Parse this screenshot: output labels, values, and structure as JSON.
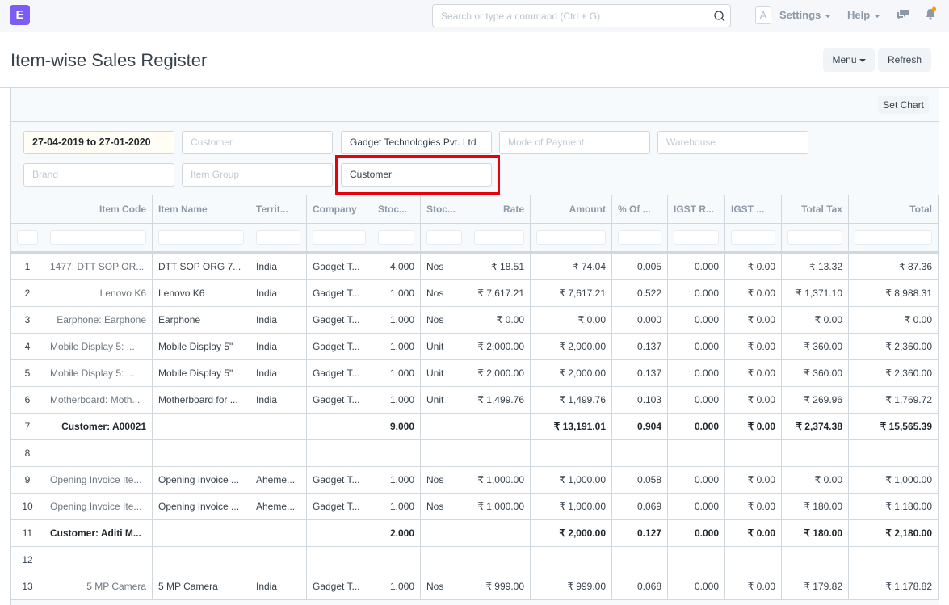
{
  "navbar": {
    "logo_letter": "E",
    "search_placeholder": "Search or type a command (Ctrl + G)",
    "avatar_letter": "A",
    "settings_label": "Settings",
    "help_label": "Help",
    "icons": [
      "search-icon",
      "chat-icon",
      "bell-icon"
    ],
    "notification_dot_color": "#ff9800",
    "brand_color": "#7b5cf6"
  },
  "page": {
    "title": "Item-wise Sales Register",
    "menu_label": "Menu",
    "refresh_label": "Refresh",
    "set_chart_label": "Set Chart"
  },
  "filters": {
    "date_range": "27-04-2019 to 27-01-2020",
    "customer_placeholder": "Customer",
    "company": "Gadget Technologies Pvt. Ltd",
    "mode_of_payment_placeholder": "Mode of Payment",
    "warehouse_placeholder": "Warehouse",
    "brand_placeholder": "Brand",
    "item_group_placeholder": "Item Group",
    "group_by": "Customer",
    "highlight_color": "#e8000b"
  },
  "table": {
    "columns": [
      "",
      "Item Code",
      "Item Name",
      "Territ...",
      "Company",
      "Stoc...",
      "Stoc...",
      "Rate",
      "Amount",
      "% Of ...",
      "IGST R...",
      "IGST ...",
      "Total Tax",
      "Total"
    ],
    "rows": [
      {
        "n": "1",
        "code": "1477: DTT SOP OR...",
        "name": "DTT SOP ORG 7...",
        "territory": "India",
        "company": "Gadget T...",
        "qty": "4.000",
        "uom": "Nos",
        "rate": "₹ 18.51",
        "amount": "₹ 74.04",
        "pct": "0.005",
        "igst_rate": "0.000",
        "igst_amt": "₹ 0.00",
        "total_tax": "₹ 13.32",
        "total": "₹ 87.36",
        "type": "item",
        "code_align": "left"
      },
      {
        "n": "2",
        "code": "Lenovo K6",
        "name": "Lenovo K6",
        "territory": "India",
        "company": "Gadget T...",
        "qty": "1.000",
        "uom": "Nos",
        "rate": "₹ 7,617.21",
        "amount": "₹ 7,617.21",
        "pct": "0.522",
        "igst_rate": "0.000",
        "igst_amt": "₹ 0.00",
        "total_tax": "₹ 1,371.10",
        "total": "₹ 8,988.31",
        "type": "item",
        "code_align": "right"
      },
      {
        "n": "3",
        "code": "Earphone: Earphone",
        "name": "Earphone",
        "territory": "India",
        "company": "Gadget T...",
        "qty": "1.000",
        "uom": "Nos",
        "rate": "₹ 0.00",
        "amount": "₹ 0.00",
        "pct": "0.000",
        "igst_rate": "0.000",
        "igst_amt": "₹ 0.00",
        "total_tax": "₹ 0.00",
        "total": "₹ 0.00",
        "type": "item",
        "code_align": "right"
      },
      {
        "n": "4",
        "code": "Mobile Display 5: ...",
        "name": "Mobile Display 5\"",
        "territory": "India",
        "company": "Gadget T...",
        "qty": "1.000",
        "uom": "Unit",
        "rate": "₹ 2,000.00",
        "amount": "₹ 2,000.00",
        "pct": "0.137",
        "igst_rate": "0.000",
        "igst_amt": "₹ 0.00",
        "total_tax": "₹ 360.00",
        "total": "₹ 2,360.00",
        "type": "item",
        "code_align": "left"
      },
      {
        "n": "5",
        "code": "Mobile Display 5: ...",
        "name": "Mobile Display 5\"",
        "territory": "India",
        "company": "Gadget T...",
        "qty": "1.000",
        "uom": "Unit",
        "rate": "₹ 2,000.00",
        "amount": "₹ 2,000.00",
        "pct": "0.137",
        "igst_rate": "0.000",
        "igst_amt": "₹ 0.00",
        "total_tax": "₹ 360.00",
        "total": "₹ 2,360.00",
        "type": "item",
        "code_align": "left"
      },
      {
        "n": "6",
        "code": "Motherboard: Moth...",
        "name": "Motherboard for ...",
        "territory": "India",
        "company": "Gadget T...",
        "qty": "1.000",
        "uom": "Unit",
        "rate": "₹ 1,499.76",
        "amount": "₹ 1,499.76",
        "pct": "0.103",
        "igst_rate": "0.000",
        "igst_amt": "₹ 0.00",
        "total_tax": "₹ 269.96",
        "total": "₹ 1,769.72",
        "type": "item",
        "code_align": "left"
      },
      {
        "n": "7",
        "code": "Customer: A00021",
        "name": "",
        "territory": "",
        "company": "",
        "qty": "9.000",
        "uom": "",
        "rate": "",
        "amount": "₹ 13,191.01",
        "pct": "0.904",
        "igst_rate": "0.000",
        "igst_amt": "₹ 0.00",
        "total_tax": "₹ 2,374.38",
        "total": "₹ 15,565.39",
        "type": "total",
        "code_align": "right"
      },
      {
        "n": "8",
        "code": "",
        "name": "",
        "territory": "",
        "company": "",
        "qty": "",
        "uom": "",
        "rate": "",
        "amount": "",
        "pct": "",
        "igst_rate": "",
        "igst_amt": "",
        "total_tax": "",
        "total": "",
        "type": "blank",
        "code_align": "left"
      },
      {
        "n": "9",
        "code": "Opening Invoice Ite...",
        "name": "Opening Invoice ...",
        "territory": "Aheme...",
        "company": "Gadget T...",
        "qty": "1.000",
        "uom": "Nos",
        "rate": "₹ 1,000.00",
        "amount": "₹ 1,000.00",
        "pct": "0.058",
        "igst_rate": "0.000",
        "igst_amt": "₹ 0.00",
        "total_tax": "₹ 0.00",
        "total": "₹ 1,000.00",
        "type": "item",
        "code_align": "left"
      },
      {
        "n": "10",
        "code": "Opening Invoice Ite...",
        "name": "Opening Invoice ...",
        "territory": "Aheme...",
        "company": "Gadget T...",
        "qty": "1.000",
        "uom": "Nos",
        "rate": "₹ 1,000.00",
        "amount": "₹ 1,000.00",
        "pct": "0.069",
        "igst_rate": "0.000",
        "igst_amt": "₹ 0.00",
        "total_tax": "₹ 180.00",
        "total": "₹ 1,180.00",
        "type": "item",
        "code_align": "left"
      },
      {
        "n": "11",
        "code": "Customer: Aditi M...",
        "name": "",
        "territory": "",
        "company": "",
        "qty": "2.000",
        "uom": "",
        "rate": "",
        "amount": "₹ 2,000.00",
        "pct": "0.127",
        "igst_rate": "0.000",
        "igst_amt": "₹ 0.00",
        "total_tax": "₹ 180.00",
        "total": "₹ 2,180.00",
        "type": "total",
        "code_align": "left"
      },
      {
        "n": "12",
        "code": "",
        "name": "",
        "territory": "",
        "company": "",
        "qty": "",
        "uom": "",
        "rate": "",
        "amount": "",
        "pct": "",
        "igst_rate": "",
        "igst_amt": "",
        "total_tax": "",
        "total": "",
        "type": "blank",
        "code_align": "left"
      },
      {
        "n": "13",
        "code": "5 MP Camera",
        "name": "5 MP Camera",
        "territory": "India",
        "company": "Gadget T...",
        "qty": "1.000",
        "uom": "Nos",
        "rate": "₹ 999.00",
        "amount": "₹ 999.00",
        "pct": "0.068",
        "igst_rate": "0.000",
        "igst_amt": "₹ 0.00",
        "total_tax": "₹ 179.82",
        "total": "₹ 1,178.82",
        "type": "item",
        "code_align": "right"
      }
    ]
  }
}
